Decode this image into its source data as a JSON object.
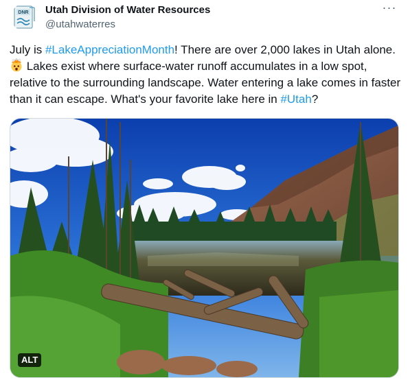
{
  "author": {
    "name": "Utah Division of Water Resources",
    "handle": "@utahwaterres",
    "avatar_text": "DNR"
  },
  "more_menu_label": "···",
  "tweet": {
    "part1": "July is ",
    "hashtag1": "#LakeAppreciationMonth",
    "part2": "! There are over 2,000 lakes in Utah alone. ",
    "emoji_name": "exploding-head-emoji",
    "part3": " Lakes exist where surface-water runoff accumulates in a low spot, relative to the surrounding landscape. Water entering a lake comes in faster than it can escape. What's your favorite lake here in ",
    "hashtag2": "#Utah",
    "part4": "?"
  },
  "media": {
    "alt_badge": "ALT"
  },
  "colors": {
    "link": "#1d9bf0",
    "text": "#0f1419",
    "muted": "#536471",
    "sky": "#1e5fc8",
    "mountain": "#8a5a44",
    "lake": "#3b4a3a",
    "grass": "#4f9a2c"
  }
}
